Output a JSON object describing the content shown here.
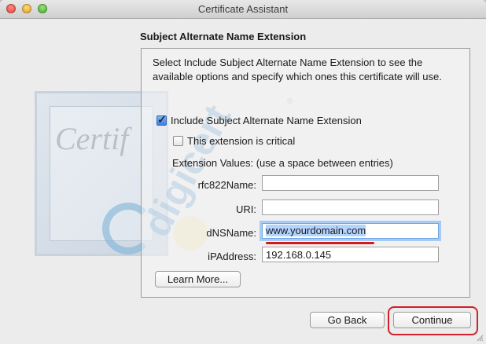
{
  "window": {
    "title": "Certificate Assistant"
  },
  "logo": {
    "certificate_text": "Certif",
    "brand_text": "digicert",
    "registered_mark": "®"
  },
  "section": {
    "heading": "Subject Alternate Name Extension",
    "description": "Select Include Subject Alternate Name Extension to see the available options and specify which ones this certificate will use."
  },
  "options": {
    "include_label": "Include Subject Alternate Name Extension",
    "include_checked": true,
    "critical_label": "This extension is critical",
    "critical_checked": false
  },
  "values": {
    "hint": "Extension Values: (use a space between entries)",
    "fields": [
      {
        "label": "rfc822Name:",
        "value": ""
      },
      {
        "label": "URI:",
        "value": ""
      },
      {
        "label": "dNSName:",
        "value": "www.yourdomain.com"
      },
      {
        "label": "iPAddress:",
        "value": "192.168.0.145"
      }
    ]
  },
  "buttons": {
    "learn_more": "Learn More...",
    "go_back": "Go Back",
    "continue": "Continue"
  },
  "colors": {
    "accent": "#3b82e0",
    "highlight": "#d3202a",
    "focus_ring": "#a8cbf3"
  }
}
